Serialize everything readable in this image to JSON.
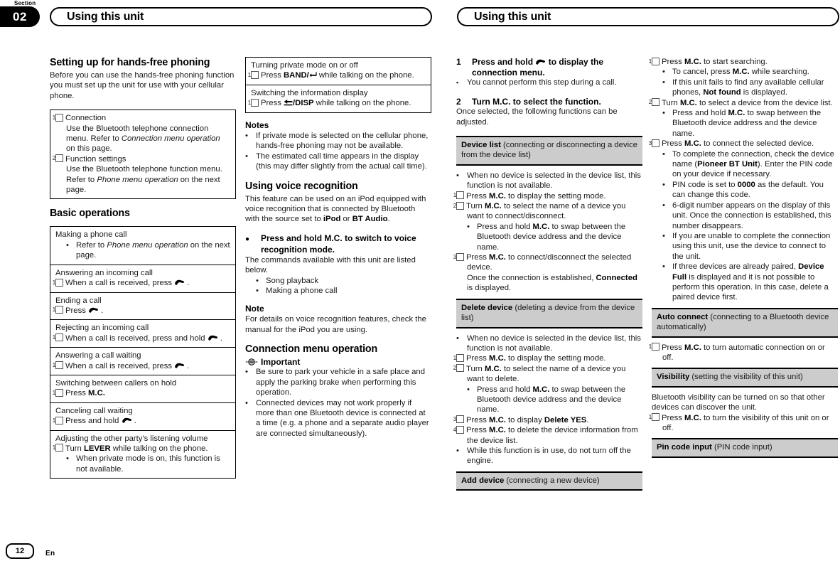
{
  "header": {
    "section_word": "Section",
    "section_number": "02",
    "banner_left": "Using this unit",
    "banner_right": "Using this unit"
  },
  "footer": {
    "page_number": "12",
    "language": "En"
  },
  "col1": {
    "heading": "Setting up for hands-free phoning",
    "intro": "Before you can use the hands-free phoning function you must set up the unit for use with your cellular phone.",
    "setup_box": {
      "item1_title": "Connection",
      "item1_body_a": "Use the Bluetooth telephone connection menu. Refer to ",
      "item1_body_i": "Connection menu operation",
      "item1_body_b": " on this page.",
      "item2_title": "Function settings",
      "item2_body_a": "Use the Bluetooth telephone function menu. Refer to ",
      "item2_body_i": "Phone menu operation",
      "item2_body_b": " on the next page."
    },
    "basic_heading": "Basic operations",
    "basic_rows": [
      {
        "title": "Making a phone call",
        "bullet_a": "Refer to ",
        "bullet_i": "Phone menu operation",
        "bullet_b": " on the next page."
      },
      {
        "title": "Answering an incoming call",
        "step": "When a call is received, press"
      },
      {
        "title": "Ending a call",
        "step": "Press"
      },
      {
        "title": "Rejecting an incoming call",
        "step": "When a call is received, press and hold"
      },
      {
        "title": "Answering a call waiting",
        "step": "When a call is received, press"
      },
      {
        "title": "Switching between callers on hold",
        "step_a": "Press ",
        "step_b": "M.C."
      },
      {
        "title": "Canceling call waiting",
        "step": "Press and hold"
      },
      {
        "title": "Adjusting the other party's listening volume",
        "step_a": "Turn ",
        "step_b": "LEVER",
        "step_c": " while talking on the phone.",
        "bullet": "When private mode is on, this function is not available."
      }
    ]
  },
  "col2": {
    "box_rows": [
      {
        "title": "Turning private mode on or off",
        "step_a": "Press ",
        "step_b": "BAND/",
        "step_c": " while talking on the phone."
      },
      {
        "title": "Switching the information display",
        "step_a": "Press ",
        "step_b": "/DISP",
        "step_c": " while talking on the phone."
      }
    ],
    "notes_heading": "Notes",
    "notes": [
      "If private mode is selected on the cellular phone, hands-free phoning may not be available.",
      "The estimated call time appears in the display (this may differ slightly from the actual call time)."
    ],
    "voice_heading": "Using voice recognition",
    "voice_intro_a": "This feature can be used on an iPod equipped with voice recognition that is connected by Bluetooth with the source set to ",
    "voice_intro_b": "iPod",
    "voice_intro_c": " or ",
    "voice_intro_d": "BT Audio",
    "voice_intro_e": ".",
    "voice_action": "Press and hold M.C. to switch to voice recognition mode.",
    "voice_body": "The commands available with this unit are listed below.",
    "voice_commands": [
      "Song playback",
      "Making a phone call"
    ],
    "note_heading": "Note",
    "note_body": "For details on voice recognition features, check the manual for the iPod you are using.",
    "conn_heading": "Connection menu operation",
    "important_label": "Important",
    "important_bullets": [
      "Be sure to park your vehicle in a safe place and apply the parking brake when performing this operation.",
      "Connected devices may not work properly if more than one Bluetooth device is connected at a time (e.g. a phone and a separate audio player are connected simultaneously)."
    ]
  },
  "col3": {
    "step1_num": "1",
    "step1_a": "Press and hold",
    "step1_b": "to display the connection menu.",
    "step1_note": "You cannot perform this step during a call.",
    "step2_num": "2",
    "step2_text": "Turn M.C. to select the function.",
    "step2_body": "Once selected, the following functions can be adjusted.",
    "device_list_bold": "Device list",
    "device_list_rest": " (connecting or disconnecting a device from the device list)",
    "device_list_items": [
      {
        "type": "bullet",
        "text": "When no device is selected in the device list, this function is not available."
      },
      {
        "type": "step",
        "num": "1",
        "a": "Press ",
        "b": "M.C.",
        "c": " to display the setting mode."
      },
      {
        "type": "step",
        "num": "2",
        "a": "Turn ",
        "b": "M.C.",
        "c": " to select the name of a device you want to connect/disconnect."
      },
      {
        "type": "bullet2",
        "a": "Press and hold ",
        "b": "M.C.",
        "c": " to swap between the Bluetooth device address and the device name."
      },
      {
        "type": "step",
        "num": "3",
        "a": "Press ",
        "b": "M.C.",
        "c": " to connect/disconnect the selected device."
      },
      {
        "type": "indent",
        "a": "Once the connection is established, ",
        "b": "Connected",
        "c": " is displayed."
      }
    ],
    "delete_device_bold": "Delete device",
    "delete_device_rest": " (deleting a device from the device list)",
    "delete_items": [
      {
        "type": "bullet",
        "text": "When no device is selected in the device list, this function is not available."
      },
      {
        "type": "step",
        "num": "1",
        "a": "Press ",
        "b": "M.C.",
        "c": " to display the setting mode."
      },
      {
        "type": "step",
        "num": "2",
        "a": "Turn ",
        "b": "M.C.",
        "c": " to select the name of a device you want to delete."
      },
      {
        "type": "bullet2",
        "a": "Press and hold ",
        "b": "M.C.",
        "c": " to swap between the Bluetooth device address and the device name."
      },
      {
        "type": "step",
        "num": "3",
        "a": "Press ",
        "b": "M.C.",
        "c": " to display ",
        "d": "Delete YES",
        "e": "."
      },
      {
        "type": "step",
        "num": "4",
        "a": "Press ",
        "b": "M.C.",
        "c": " to delete the device information from the device list."
      },
      {
        "type": "bullet",
        "text": "While this function is in use, do not turn off the engine."
      }
    ],
    "add_device_bold": "Add device",
    "add_device_rest": " (connecting a new device)"
  },
  "col4": {
    "add_items": [
      {
        "type": "step",
        "num": "1",
        "a": "Press ",
        "b": "M.C.",
        "c": " to start searching."
      },
      {
        "type": "bullet2",
        "a": "To cancel, press ",
        "b": "M.C.",
        "c": " while searching."
      },
      {
        "type": "bullet2",
        "a": "If this unit fails to find any available cellular phones, ",
        "b": "Not found",
        "c": " is displayed."
      },
      {
        "type": "step",
        "num": "2",
        "a": "Turn ",
        "b": "M.C.",
        "c": " to select a device from the device list."
      },
      {
        "type": "bullet2",
        "a": "Press and hold ",
        "b": "M.C.",
        "c": " to swap between the Bluetooth device address and the device name."
      },
      {
        "type": "step",
        "num": "3",
        "a": "Press ",
        "b": "M.C.",
        "c": " to connect the selected device."
      },
      {
        "type": "bullet2",
        "a": "To complete the connection, check the device name (",
        "b": "Pioneer BT Unit",
        "c": "). Enter the PIN code on your device if necessary."
      },
      {
        "type": "bullet2",
        "a": "PIN code is set to ",
        "b": "0000",
        "c": " as the default. You can change this code."
      },
      {
        "type": "bullet2",
        "a": "6-digit number appears on the display of this unit. Once the connection is established, this number disappears.",
        "b": "",
        "c": ""
      },
      {
        "type": "bullet2",
        "a": "If you are unable to complete the connection using this unit, use the device to connect to the unit.",
        "b": "",
        "c": ""
      },
      {
        "type": "bullet2",
        "a": "If three devices are already paired, ",
        "b": "Device Full",
        "c": " is displayed and it is not possible to perform this operation. In this case, delete a paired device first."
      }
    ],
    "auto_connect_bold": "Auto connect",
    "auto_connect_rest": " (connecting to a Bluetooth device automatically)",
    "auto_connect_step": {
      "num": "1",
      "a": "Press ",
      "b": "M.C.",
      "c": " to turn automatic connection on or off."
    },
    "visibility_bold": "Visibility",
    "visibility_rest": " (setting the visibility of this unit)",
    "visibility_body": "Bluetooth visibility can be turned on so that other devices can discover the unit.",
    "visibility_step": {
      "num": "1",
      "a": "Press ",
      "b": "M.C.",
      "c": " to turn the visibility of this unit on or off."
    },
    "pin_bold": "Pin code input",
    "pin_rest": " (PIN code input)"
  },
  "icons": {
    "phone": "phone-handset-icon",
    "band": "band-return-icon",
    "disp": "disp-arrow-icon",
    "important": "important-bulb-icon"
  }
}
